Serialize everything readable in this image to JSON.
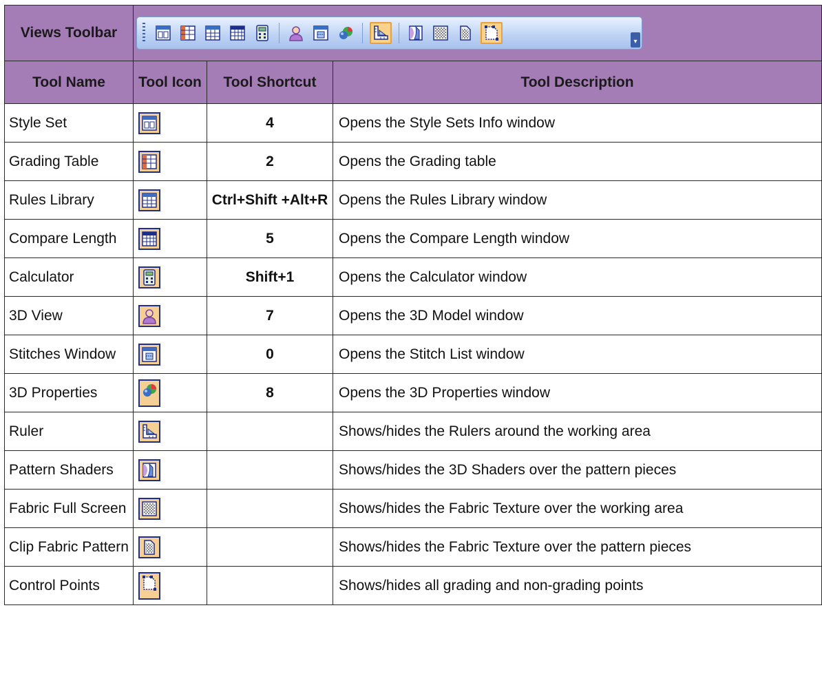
{
  "toolbar_title": "Views Toolbar",
  "headers": {
    "tool_name": "Tool Name",
    "tool_icon": "Tool Icon",
    "tool_shortcut": "Tool Shortcut",
    "tool_description": "Tool Description"
  },
  "toolbar_icons": [
    "style-set-icon",
    "grading-table-icon",
    "rules-library-icon",
    "compare-length-icon",
    "calculator-icon",
    "3d-view-icon",
    "stitches-window-icon",
    "3d-properties-icon",
    "ruler-icon",
    "pattern-shaders-icon",
    "fabric-full-screen-icon",
    "clip-fabric-pattern-icon",
    "control-points-icon"
  ],
  "rows": [
    {
      "name": "Style Set",
      "icon": "style-set-icon",
      "shortcut": "4",
      "description": "Opens the Style Sets Info window"
    },
    {
      "name": "Grading Table",
      "icon": "grading-table-icon",
      "shortcut": "2",
      "description": "Opens the Grading table"
    },
    {
      "name": "Rules Library",
      "icon": "rules-library-icon",
      "shortcut": "Ctrl+Shift +Alt+R",
      "description": "Opens the Rules Library window"
    },
    {
      "name": "Compare Length",
      "icon": "compare-length-icon",
      "shortcut": "5",
      "description": "Opens the Compare Length window"
    },
    {
      "name": "Calculator",
      "icon": "calculator-icon",
      "shortcut": "Shift+1",
      "description": "Opens the Calculator window"
    },
    {
      "name": "3D View",
      "icon": "3d-view-icon",
      "shortcut": "7",
      "description": "Opens the 3D Model window"
    },
    {
      "name": "Stitches Window",
      "icon": "stitches-window-icon",
      "shortcut": "0",
      "description": "Opens the Stitch List window"
    },
    {
      "name": "3D Properties",
      "icon": "3d-properties-icon",
      "shortcut": "8",
      "description": "Opens the 3D Properties window"
    },
    {
      "name": "Ruler",
      "icon": "ruler-icon",
      "shortcut": "",
      "description": "Shows/hides the Rulers around the working area"
    },
    {
      "name": "Pattern Shaders",
      "icon": "pattern-shaders-icon",
      "shortcut": "",
      "description": "Shows/hides the 3D Shaders over the pattern pieces"
    },
    {
      "name": "Fabric Full Screen",
      "icon": "fabric-full-screen-icon",
      "shortcut": "",
      "description": "Shows/hides the Fabric Texture over the working area"
    },
    {
      "name": "Clip Fabric Pattern",
      "icon": "clip-fabric-pattern-icon",
      "shortcut": "",
      "description": "Shows/hides the Fabric Texture over the pattern pieces"
    },
    {
      "name": "Control Points",
      "icon": "control-points-icon",
      "shortcut": "",
      "description": "Shows/hides all grading and non-grading points"
    }
  ]
}
